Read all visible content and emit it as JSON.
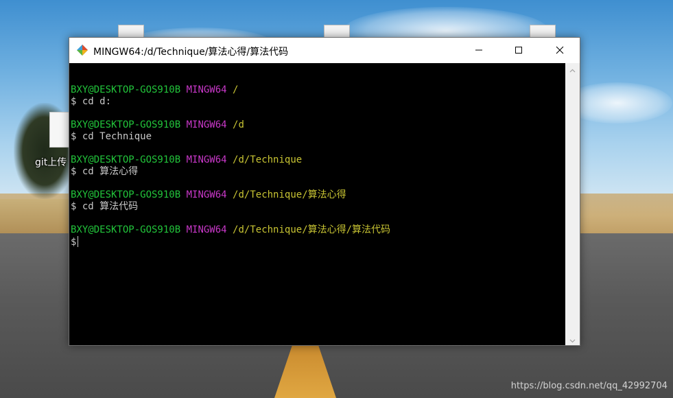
{
  "desktop": {
    "icon_label": "git上传",
    "watermark": "https://blog.csdn.net/qq_42992704"
  },
  "window": {
    "title": "MINGW64:/d/Technique/算法心得/算法代码",
    "icon": "git-bash-icon",
    "controls": [
      "minimize-icon",
      "maximize-icon",
      "close-icon"
    ]
  },
  "terminal": {
    "blocks": [
      {
        "user": "BXY@DESKTOP-GOS910B",
        "env": "MINGW64",
        "path": "/",
        "command": "$ cd d:"
      },
      {
        "user": "BXY@DESKTOP-GOS910B",
        "env": "MINGW64",
        "path": "/d",
        "command": "$ cd Technique"
      },
      {
        "user": "BXY@DESKTOP-GOS910B",
        "env": "MINGW64",
        "path": "/d/Technique",
        "command": "$ cd 算法心得"
      },
      {
        "user": "BXY@DESKTOP-GOS910B",
        "env": "MINGW64",
        "path": "/d/Technique/算法心得",
        "command": "$ cd 算法代码"
      },
      {
        "user": "BXY@DESKTOP-GOS910B",
        "env": "MINGW64",
        "path": "/d/Technique/算法心得/算法代码",
        "command": "$"
      }
    ]
  },
  "colors": {
    "user": "#22c53b",
    "env": "#c938c9",
    "path": "#c8c433",
    "text": "#c8c8c8"
  }
}
